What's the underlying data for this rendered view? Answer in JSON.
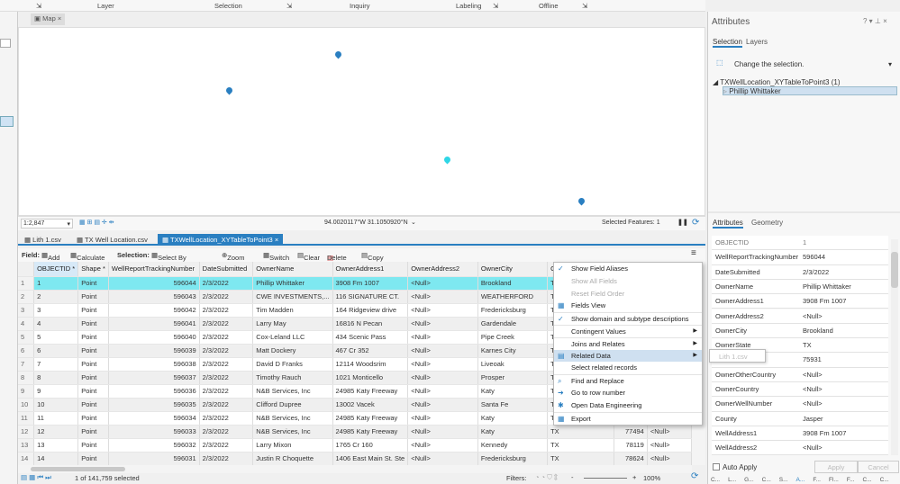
{
  "ribbon": {
    "groups": [
      "Layer",
      "Selection",
      "Inquiry",
      "Labeling",
      "Offline"
    ]
  },
  "map": {
    "tab": "Map",
    "scale": "1:2,847",
    "coords": "94.0020117°W 31.1050920°N",
    "selected_features": "Selected Features: 1",
    "colors": {
      "pin": "#2a7fc1",
      "pin_selected": "#2fd6e6"
    }
  },
  "table_tabs": [
    "Lith 1.csv",
    "TX Well Location.csv",
    "TXWellLocation_XYTableToPoint3"
  ],
  "toolbar": {
    "field_label": "Field:",
    "add": "Add",
    "calculate": "Calculate",
    "selection_label": "Selection:",
    "select_by_attributes": "Select By Attributes",
    "zoom_to": "Zoom To",
    "switch": "Switch",
    "clear": "Clear",
    "delete": "Delete",
    "copy": "Copy"
  },
  "columns": [
    "OBJECTID *",
    "Shape *",
    "WellReportTrackingNumber",
    "DateSubmitted",
    "OwnerName",
    "OwnerAddress1",
    "OwnerAddress2",
    "OwnerCity",
    "Ow",
    "",
    ""
  ],
  "rows": [
    [
      "1",
      "1",
      "Point",
      "596044",
      "2/3/2022",
      "Phillip Whittaker",
      "3908 Fm 1007",
      "<Null>",
      "Brookland",
      "TX",
      "",
      ""
    ],
    [
      "2",
      "2",
      "Point",
      "596043",
      "2/3/2022",
      "CWE INVESTMENTS,...",
      "116 SIGNATURE CT.",
      "<Null>",
      "WEATHERFORD",
      "TX",
      "",
      ""
    ],
    [
      "3",
      "3",
      "Point",
      "596042",
      "2/3/2022",
      "Tim Madden",
      "164 Ridgeview drive",
      "<Null>",
      "Fredericksburg",
      "TX",
      "",
      ""
    ],
    [
      "4",
      "4",
      "Point",
      "596041",
      "2/3/2022",
      "Larry May",
      "16816 N Pecan",
      "<Null>",
      "Gardendale",
      "TX",
      "",
      ""
    ],
    [
      "5",
      "5",
      "Point",
      "596040",
      "2/3/2022",
      "Cox-Leland LLC",
      "434 Scenic Pass",
      "<Null>",
      "Pipe Creek",
      "TX",
      "",
      ""
    ],
    [
      "6",
      "6",
      "Point",
      "596039",
      "2/3/2022",
      "Matt Dockery",
      "467 Cr 352",
      "<Null>",
      "Karnes City",
      "TX",
      "",
      ""
    ],
    [
      "7",
      "7",
      "Point",
      "596038",
      "2/3/2022",
      "David D Franks",
      "12114 Woodsrim",
      "<Null>",
      "Liveoak",
      "TX",
      "",
      ""
    ],
    [
      "8",
      "8",
      "Point",
      "596037",
      "2/3/2022",
      "Timothy Rauch",
      "1021 Monticello",
      "<Null>",
      "Prosper",
      "TX",
      "",
      ""
    ],
    [
      "9",
      "9",
      "Point",
      "596036",
      "2/3/2022",
      "N&B Services, Inc",
      "24985 Katy Freeway",
      "<Null>",
      "Katy",
      "TX",
      "",
      ""
    ],
    [
      "10",
      "10",
      "Point",
      "596035",
      "2/3/2022",
      "Clifford Dupree",
      "13002 Vacek",
      "<Null>",
      "Santa Fe",
      "TX",
      "",
      ""
    ],
    [
      "11",
      "11",
      "Point",
      "596034",
      "2/3/2022",
      "N&B Services, Inc",
      "24985 Katy Freeway",
      "<Null>",
      "Katy",
      "TX",
      "",
      ""
    ],
    [
      "12",
      "12",
      "Point",
      "596033",
      "2/3/2022",
      "N&B Services, Inc",
      "24985 Katy Freeway",
      "<Null>",
      "Katy",
      "TX",
      "77494",
      "<Null>"
    ],
    [
      "13",
      "13",
      "Point",
      "596032",
      "2/3/2022",
      "Larry Mixon",
      "1765 Cr 160",
      "<Null>",
      "Kennedy",
      "TX",
      "78119",
      "<Null>"
    ],
    [
      "14",
      "14",
      "Point",
      "596031",
      "2/3/2022",
      "Justin R Choquette",
      "1406 East Main St. Ste",
      "<Null>",
      "Fredericksburg",
      "TX",
      "78624",
      "<Null>"
    ]
  ],
  "status": {
    "selected": "1 of 141,759 selected",
    "filters": "Filters:",
    "zoom": "100%"
  },
  "menu": [
    {
      "label": "Show Field Aliases",
      "icon": "✓"
    },
    {
      "label": "Show All Fields",
      "disabled": true
    },
    {
      "label": "Reset Field Order",
      "disabled": true
    },
    {
      "label": "Fields View",
      "icon": "▦"
    },
    {
      "label": "Show domain and subtype descriptions",
      "icon": "✓",
      "sep": true
    },
    {
      "label": "Contingent Values",
      "arrow": true,
      "sep": true
    },
    {
      "label": "Joins and Relates",
      "arrow": true,
      "sep": true
    },
    {
      "label": "Related Data",
      "arrow": true,
      "icon": "▤",
      "highlight": true
    },
    {
      "label": "Select related records"
    },
    {
      "label": "Find and Replace",
      "icon": "⌕",
      "sep": true
    },
    {
      "label": "Go to row number",
      "icon": "➜"
    },
    {
      "label": "Open Data Engineering",
      "icon": "✱"
    },
    {
      "label": "Export",
      "icon": "▦",
      "sep": true
    }
  ],
  "submenu": "Lith 1.csv",
  "attributes": {
    "title": "Attributes",
    "tabs": [
      "Selection",
      "Layers"
    ],
    "change_selection": "Change the selection.",
    "layer": "TXWellLocation_XYTableToPoint3 (1)",
    "feature": "Phillip Whittaker",
    "lower_tabs": [
      "Attributes",
      "Geometry"
    ],
    "fields": [
      [
        "OBJECTID",
        "1"
      ],
      [
        "WellReportTrackingNumber",
        "596044"
      ],
      [
        "DateSubmitted",
        "2/3/2022"
      ],
      [
        "OwnerName",
        "Phillip Whittaker"
      ],
      [
        "OwnerAddress1",
        "3908 Fm 1007"
      ],
      [
        "OwnerAddress2",
        "<Null>"
      ],
      [
        "OwnerCity",
        "Brookland"
      ],
      [
        "OwnerState",
        "TX"
      ],
      [
        "",
        "75931"
      ],
      [
        "OwnerOtherCountry",
        "<Null>"
      ],
      [
        "OwnerCountry",
        "<Null>"
      ],
      [
        "OwnerWellNumber",
        "<Null>"
      ],
      [
        "County",
        "Jasper"
      ],
      [
        "WellAddress1",
        "3908 Fm 1007"
      ],
      [
        "WellAddress2",
        "<Null>"
      ]
    ],
    "auto_apply": "Auto Apply",
    "apply": "Apply",
    "cancel": "Cancel",
    "bottom_tabs": [
      "C...",
      "L...",
      "G...",
      "C...",
      "S...",
      "A...",
      "F...",
      "Fl...",
      "F...",
      "C...",
      "C..."
    ]
  }
}
